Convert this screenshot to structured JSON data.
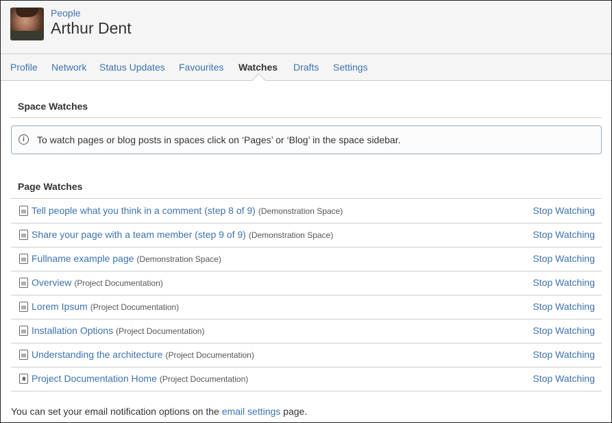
{
  "header": {
    "breadcrumb": "People",
    "title": "Arthur Dent"
  },
  "nav": {
    "tabs": [
      {
        "label": "Profile",
        "active": false
      },
      {
        "label": "Network",
        "active": false
      },
      {
        "label": "Status Updates",
        "active": false
      },
      {
        "label": "Favourites",
        "active": false
      },
      {
        "label": "Watches",
        "active": true
      },
      {
        "label": "Drafts",
        "active": false
      },
      {
        "label": "Settings",
        "active": false
      }
    ]
  },
  "space_watches": {
    "heading": "Space Watches",
    "info_icon": "info-circle-icon",
    "info_message": "To watch pages or blog posts in spaces click on ‘Pages’ or ‘Blog’ in the space sidebar."
  },
  "page_watches": {
    "heading": "Page Watches",
    "stop_label": "Stop Watching",
    "items": [
      {
        "title": "Tell people what you think in a comment (step 8 of 9)",
        "space": "(Demonstration Space)",
        "icon": "page-icon"
      },
      {
        "title": "Share your page with a team member (step 9 of 9)",
        "space": "(Demonstration Space)",
        "icon": "page-icon"
      },
      {
        "title": "Fullname example page",
        "space": "(Demonstration Space)",
        "icon": "page-icon"
      },
      {
        "title": "Overview",
        "space": "(Project Documentation)",
        "icon": "page-icon"
      },
      {
        "title": "Lorem Ipsum",
        "space": "(Project Documentation)",
        "icon": "page-icon"
      },
      {
        "title": "Installation Options",
        "space": "(Project Documentation)",
        "icon": "page-icon"
      },
      {
        "title": "Understanding the architecture",
        "space": "(Project Documentation)",
        "icon": "page-icon"
      },
      {
        "title": "Project Documentation Home",
        "space": "(Project Documentation)",
        "icon": "home-page-icon"
      }
    ]
  },
  "footer": {
    "before": "You can set your email notification options on the ",
    "link": "email settings",
    "after": " page."
  },
  "colors": {
    "link": "#3b73af",
    "header_bg": "#f5f5f5",
    "text": "#333333"
  }
}
